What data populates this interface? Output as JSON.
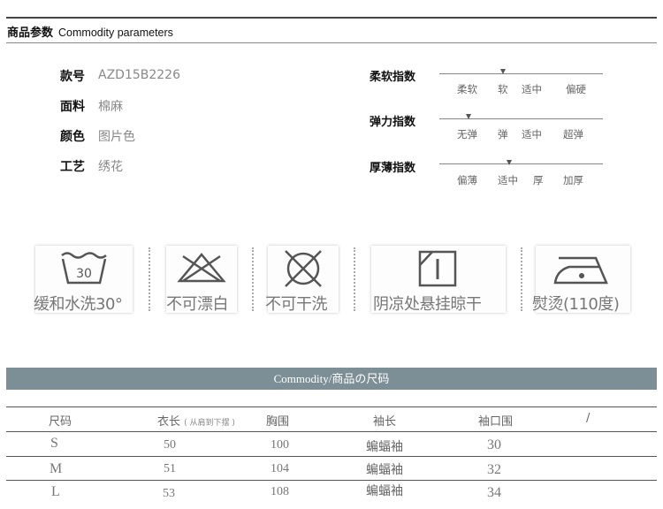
{
  "header": {
    "title_cn": "商品参数",
    "title_en": "Commodity parameters"
  },
  "params": [
    {
      "label": "款号",
      "value": "AZD15B2226"
    },
    {
      "label": "面料",
      "value": "棉麻"
    },
    {
      "label": "颜色",
      "value": "图片色"
    },
    {
      "label": "工艺",
      "value": "绣花"
    }
  ],
  "scales": [
    {
      "label": "柔软指数",
      "ticks": [
        "柔软",
        "软",
        "适中",
        "偏硬"
      ],
      "level_index": 1
    },
    {
      "label": "弹力指数",
      "ticks": [
        "无弹",
        "弹",
        "适中",
        "超弹"
      ],
      "level_index": 0
    },
    {
      "label": "厚薄指数",
      "ticks": [
        "偏薄",
        "适中",
        "厚",
        "加厚"
      ],
      "level_index": 1
    }
  ],
  "care": [
    {
      "icon": "wash-30-icon",
      "symbol": "30",
      "caption": "缓和水洗30°"
    },
    {
      "icon": "no-bleach-icon",
      "caption": "不可漂白"
    },
    {
      "icon": "no-dry-clean-icon",
      "caption": "不可干洗"
    },
    {
      "icon": "shade-line-dry-icon",
      "caption": "阴凉处悬挂晾干"
    },
    {
      "icon": "iron-icon",
      "caption": "熨烫(110度)"
    }
  ],
  "size_table": {
    "title": "Commodity/商品の尺码",
    "headers": [
      "尺码",
      "衣长",
      "胸围",
      "袖长",
      "袖口围",
      "/"
    ],
    "length_note": "( 从肩到下摆 )",
    "rows": [
      [
        "S",
        "50",
        "100",
        "蝙蝠袖",
        "30"
      ],
      [
        "M",
        "51",
        "104",
        "蝙蝠袖",
        "32"
      ],
      [
        "L",
        "53",
        "108",
        "蝙蝠袖",
        "34"
      ]
    ]
  }
}
